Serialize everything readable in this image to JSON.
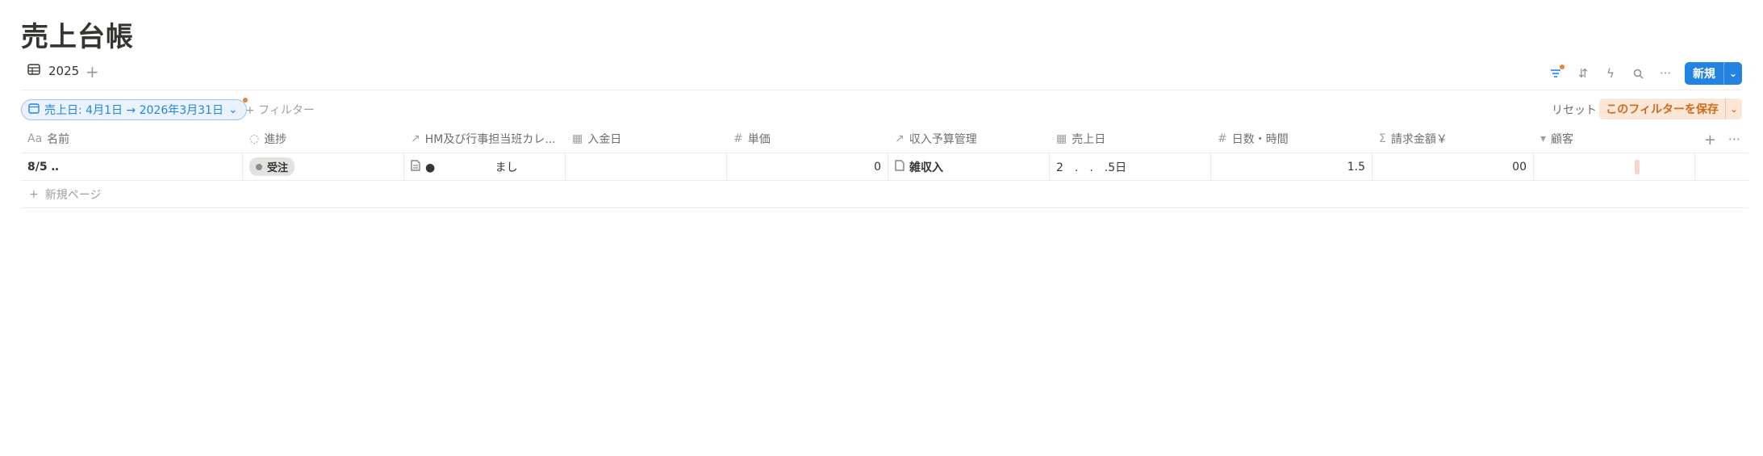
{
  "page": {
    "title": "売上台帳"
  },
  "view": {
    "tab_label": "2025",
    "add_label": "+"
  },
  "toolbar": {
    "new_label": "新規"
  },
  "filters": {
    "active_chip": "売上日: 4月1日 → 2026年3月31日",
    "add_filter": "+ フィルター",
    "reset": "リセット",
    "save": "このフィルターを保存"
  },
  "table": {
    "columns": [
      {
        "icon": "Aa",
        "label": "名前"
      },
      {
        "icon": "◌",
        "label": "進捗"
      },
      {
        "icon": "↗",
        "label": "HM及び行事担当班カレ..."
      },
      {
        "icon": "▦",
        "label": "入金日"
      },
      {
        "icon": "#",
        "label": "単価"
      },
      {
        "icon": "↗",
        "label": "収入予算管理"
      },
      {
        "icon": "▦",
        "label": "売上日"
      },
      {
        "icon": "#",
        "label": "日数・時間"
      },
      {
        "icon": "Σ",
        "label": "請求金額￥"
      },
      {
        "icon": "▾",
        "label": "顧客"
      }
    ],
    "row": {
      "name": "8/5 ‥",
      "status": "受注",
      "hm_relation": "●　　　　　 まし",
      "payment_date": "",
      "unit_price": "0",
      "budget": "雑収入",
      "sales_date": "2　.　.　.5日",
      "days_hours": "1.5",
      "invoice_amount": "00",
      "customer": ""
    },
    "new_page_label": "新規ページ"
  }
}
